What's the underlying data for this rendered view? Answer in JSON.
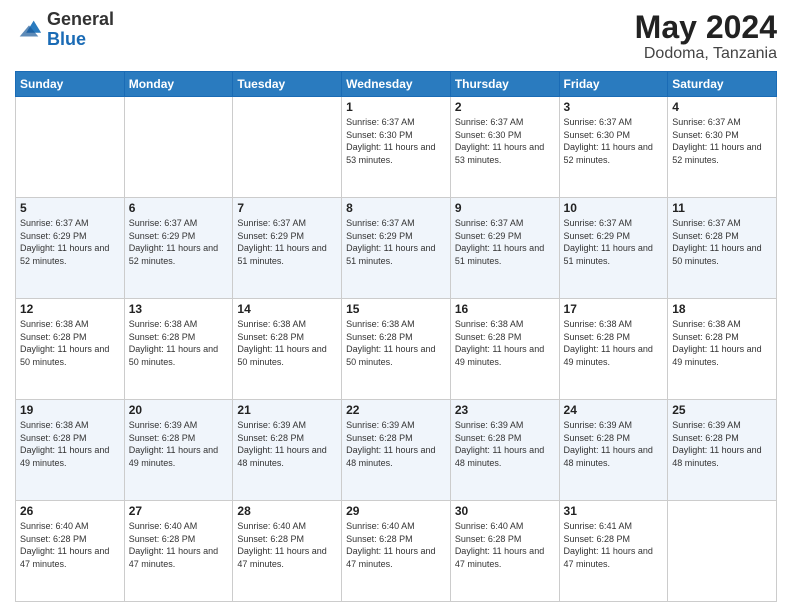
{
  "header": {
    "logo_general": "General",
    "logo_blue": "Blue",
    "month_year": "May 2024",
    "location": "Dodoma, Tanzania"
  },
  "weekdays": [
    "Sunday",
    "Monday",
    "Tuesday",
    "Wednesday",
    "Thursday",
    "Friday",
    "Saturday"
  ],
  "weeks": [
    [
      {
        "day": "",
        "sunrise": "",
        "sunset": "",
        "daylight": ""
      },
      {
        "day": "",
        "sunrise": "",
        "sunset": "",
        "daylight": ""
      },
      {
        "day": "",
        "sunrise": "",
        "sunset": "",
        "daylight": ""
      },
      {
        "day": "1",
        "sunrise": "Sunrise: 6:37 AM",
        "sunset": "Sunset: 6:30 PM",
        "daylight": "Daylight: 11 hours and 53 minutes."
      },
      {
        "day": "2",
        "sunrise": "Sunrise: 6:37 AM",
        "sunset": "Sunset: 6:30 PM",
        "daylight": "Daylight: 11 hours and 53 minutes."
      },
      {
        "day": "3",
        "sunrise": "Sunrise: 6:37 AM",
        "sunset": "Sunset: 6:30 PM",
        "daylight": "Daylight: 11 hours and 52 minutes."
      },
      {
        "day": "4",
        "sunrise": "Sunrise: 6:37 AM",
        "sunset": "Sunset: 6:30 PM",
        "daylight": "Daylight: 11 hours and 52 minutes."
      }
    ],
    [
      {
        "day": "5",
        "sunrise": "Sunrise: 6:37 AM",
        "sunset": "Sunset: 6:29 PM",
        "daylight": "Daylight: 11 hours and 52 minutes."
      },
      {
        "day": "6",
        "sunrise": "Sunrise: 6:37 AM",
        "sunset": "Sunset: 6:29 PM",
        "daylight": "Daylight: 11 hours and 52 minutes."
      },
      {
        "day": "7",
        "sunrise": "Sunrise: 6:37 AM",
        "sunset": "Sunset: 6:29 PM",
        "daylight": "Daylight: 11 hours and 51 minutes."
      },
      {
        "day": "8",
        "sunrise": "Sunrise: 6:37 AM",
        "sunset": "Sunset: 6:29 PM",
        "daylight": "Daylight: 11 hours and 51 minutes."
      },
      {
        "day": "9",
        "sunrise": "Sunrise: 6:37 AM",
        "sunset": "Sunset: 6:29 PM",
        "daylight": "Daylight: 11 hours and 51 minutes."
      },
      {
        "day": "10",
        "sunrise": "Sunrise: 6:37 AM",
        "sunset": "Sunset: 6:29 PM",
        "daylight": "Daylight: 11 hours and 51 minutes."
      },
      {
        "day": "11",
        "sunrise": "Sunrise: 6:37 AM",
        "sunset": "Sunset: 6:28 PM",
        "daylight": "Daylight: 11 hours and 50 minutes."
      }
    ],
    [
      {
        "day": "12",
        "sunrise": "Sunrise: 6:38 AM",
        "sunset": "Sunset: 6:28 PM",
        "daylight": "Daylight: 11 hours and 50 minutes."
      },
      {
        "day": "13",
        "sunrise": "Sunrise: 6:38 AM",
        "sunset": "Sunset: 6:28 PM",
        "daylight": "Daylight: 11 hours and 50 minutes."
      },
      {
        "day": "14",
        "sunrise": "Sunrise: 6:38 AM",
        "sunset": "Sunset: 6:28 PM",
        "daylight": "Daylight: 11 hours and 50 minutes."
      },
      {
        "day": "15",
        "sunrise": "Sunrise: 6:38 AM",
        "sunset": "Sunset: 6:28 PM",
        "daylight": "Daylight: 11 hours and 50 minutes."
      },
      {
        "day": "16",
        "sunrise": "Sunrise: 6:38 AM",
        "sunset": "Sunset: 6:28 PM",
        "daylight": "Daylight: 11 hours and 49 minutes."
      },
      {
        "day": "17",
        "sunrise": "Sunrise: 6:38 AM",
        "sunset": "Sunset: 6:28 PM",
        "daylight": "Daylight: 11 hours and 49 minutes."
      },
      {
        "day": "18",
        "sunrise": "Sunrise: 6:38 AM",
        "sunset": "Sunset: 6:28 PM",
        "daylight": "Daylight: 11 hours and 49 minutes."
      }
    ],
    [
      {
        "day": "19",
        "sunrise": "Sunrise: 6:38 AM",
        "sunset": "Sunset: 6:28 PM",
        "daylight": "Daylight: 11 hours and 49 minutes."
      },
      {
        "day": "20",
        "sunrise": "Sunrise: 6:39 AM",
        "sunset": "Sunset: 6:28 PM",
        "daylight": "Daylight: 11 hours and 49 minutes."
      },
      {
        "day": "21",
        "sunrise": "Sunrise: 6:39 AM",
        "sunset": "Sunset: 6:28 PM",
        "daylight": "Daylight: 11 hours and 48 minutes."
      },
      {
        "day": "22",
        "sunrise": "Sunrise: 6:39 AM",
        "sunset": "Sunset: 6:28 PM",
        "daylight": "Daylight: 11 hours and 48 minutes."
      },
      {
        "day": "23",
        "sunrise": "Sunrise: 6:39 AM",
        "sunset": "Sunset: 6:28 PM",
        "daylight": "Daylight: 11 hours and 48 minutes."
      },
      {
        "day": "24",
        "sunrise": "Sunrise: 6:39 AM",
        "sunset": "Sunset: 6:28 PM",
        "daylight": "Daylight: 11 hours and 48 minutes."
      },
      {
        "day": "25",
        "sunrise": "Sunrise: 6:39 AM",
        "sunset": "Sunset: 6:28 PM",
        "daylight": "Daylight: 11 hours and 48 minutes."
      }
    ],
    [
      {
        "day": "26",
        "sunrise": "Sunrise: 6:40 AM",
        "sunset": "Sunset: 6:28 PM",
        "daylight": "Daylight: 11 hours and 47 minutes."
      },
      {
        "day": "27",
        "sunrise": "Sunrise: 6:40 AM",
        "sunset": "Sunset: 6:28 PM",
        "daylight": "Daylight: 11 hours and 47 minutes."
      },
      {
        "day": "28",
        "sunrise": "Sunrise: 6:40 AM",
        "sunset": "Sunset: 6:28 PM",
        "daylight": "Daylight: 11 hours and 47 minutes."
      },
      {
        "day": "29",
        "sunrise": "Sunrise: 6:40 AM",
        "sunset": "Sunset: 6:28 PM",
        "daylight": "Daylight: 11 hours and 47 minutes."
      },
      {
        "day": "30",
        "sunrise": "Sunrise: 6:40 AM",
        "sunset": "Sunset: 6:28 PM",
        "daylight": "Daylight: 11 hours and 47 minutes."
      },
      {
        "day": "31",
        "sunrise": "Sunrise: 6:41 AM",
        "sunset": "Sunset: 6:28 PM",
        "daylight": "Daylight: 11 hours and 47 minutes."
      },
      {
        "day": "",
        "sunrise": "",
        "sunset": "",
        "daylight": ""
      }
    ]
  ]
}
